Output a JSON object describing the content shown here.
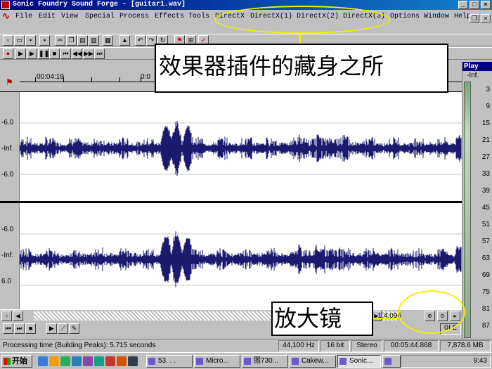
{
  "window": {
    "title": "Sonic Foundry Sound Forge - [guitar1.wav]"
  },
  "menu": {
    "items": [
      "File",
      "Edit",
      "View",
      "Special",
      "Process",
      "Effects",
      "Tools",
      "DirectX",
      "DirectX(1)",
      "DirectX(2)",
      "DirectX(3)",
      "Options",
      "Window",
      "Help"
    ]
  },
  "ruler": {
    "time_label": "00:04:19",
    "time_label_2": "0:0"
  },
  "waveform": {
    "color": "#1a1a6e",
    "left_channel_labels": [
      "-6.0",
      "-Inf.",
      "-6.0"
    ],
    "right_channel_labels": [
      "-6.0",
      "-Inf.",
      "6.0"
    ]
  },
  "zoom": {
    "ratio": "1:4,096"
  },
  "ole": "OLE",
  "status": {
    "processing": "Processing time (Building Peaks): 5.715 seconds",
    "sample_rate": "44,100 Hz",
    "bit_depth": "16 bit",
    "channels": "Stereo",
    "length": "00:05:44.868",
    "size": "7,878.6 MB"
  },
  "play_panel": {
    "title": "Play",
    "header": "-Inf.",
    "ticks": [
      "3",
      "9",
      "15",
      "21",
      "27",
      "33",
      "39",
      "45",
      "51",
      "57",
      "63",
      "69",
      "75",
      "81",
      "87"
    ]
  },
  "annotations": {
    "top_note": "效果器插件的藏身之所",
    "bottom_note": "放大镜",
    "highlight_color": "#f0f000"
  },
  "taskbar": {
    "start": "开始",
    "tasks": [
      "53. . .",
      "Micro...",
      "图730...",
      "Cakew...",
      "Sonic...",
      ""
    ],
    "clock": "9:43"
  }
}
